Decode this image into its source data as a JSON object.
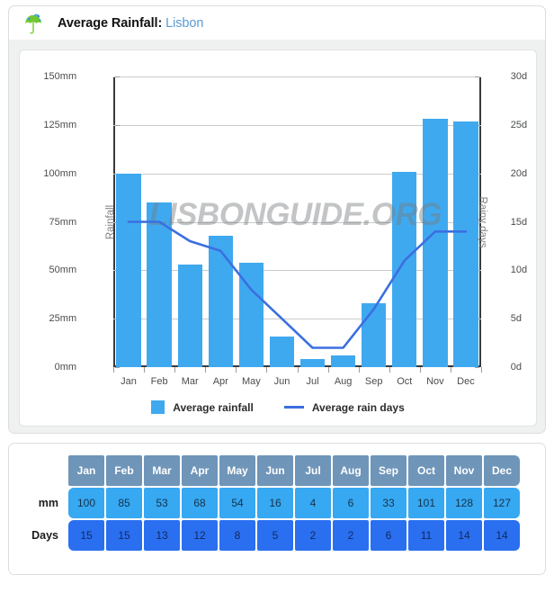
{
  "header": {
    "icon": "umbrella-icon",
    "title_prefix": "Average Rainfall:",
    "city": "Lisbon"
  },
  "watermark": "LISBONGUIDE.ORG",
  "legend": {
    "bars_label": "Average rainfall",
    "line_label": "Average rain days"
  },
  "table": {
    "row_label_mm": "mm",
    "row_label_days": "Days"
  },
  "colors": {
    "bar": "#3fa9f0",
    "line": "#3b6fe0",
    "table_header": "#6f95b9",
    "table_mm": "#37a8f2",
    "table_days": "#2a6ff0",
    "city_text": "#5b9bd5"
  },
  "chart_data": {
    "type": "bar",
    "title": "Average Rainfall: Lisbon",
    "categories": [
      "Jan",
      "Feb",
      "Mar",
      "Apr",
      "May",
      "Jun",
      "Jul",
      "Aug",
      "Sep",
      "Oct",
      "Nov",
      "Dec"
    ],
    "series": [
      {
        "name": "Average rainfall",
        "type": "bar",
        "axis": "left",
        "unit": "mm",
        "values": [
          100,
          85,
          53,
          68,
          54,
          16,
          4,
          6,
          33,
          101,
          128,
          127
        ]
      },
      {
        "name": "Average rain days",
        "type": "line",
        "axis": "right",
        "unit": "d",
        "values": [
          15,
          15,
          13,
          12,
          8,
          5,
          2,
          2,
          6,
          11,
          14,
          14
        ]
      }
    ],
    "xlabel": "",
    "ylabel": "Rainfall",
    "y2label": "Rainy days",
    "ylim": [
      0,
      150
    ],
    "y2lim": [
      0,
      30
    ],
    "yticks": [
      0,
      25,
      50,
      75,
      100,
      125,
      150
    ],
    "ytick_labels": [
      "0mm",
      "25mm",
      "50mm",
      "75mm",
      "100mm",
      "125mm",
      "150mm"
    ],
    "y2ticks": [
      0,
      5,
      10,
      15,
      20,
      25,
      30
    ],
    "y2tick_labels": [
      "0d",
      "5d",
      "10d",
      "15d",
      "20d",
      "25d",
      "30d"
    ],
    "grid": true,
    "legend_position": "bottom"
  }
}
